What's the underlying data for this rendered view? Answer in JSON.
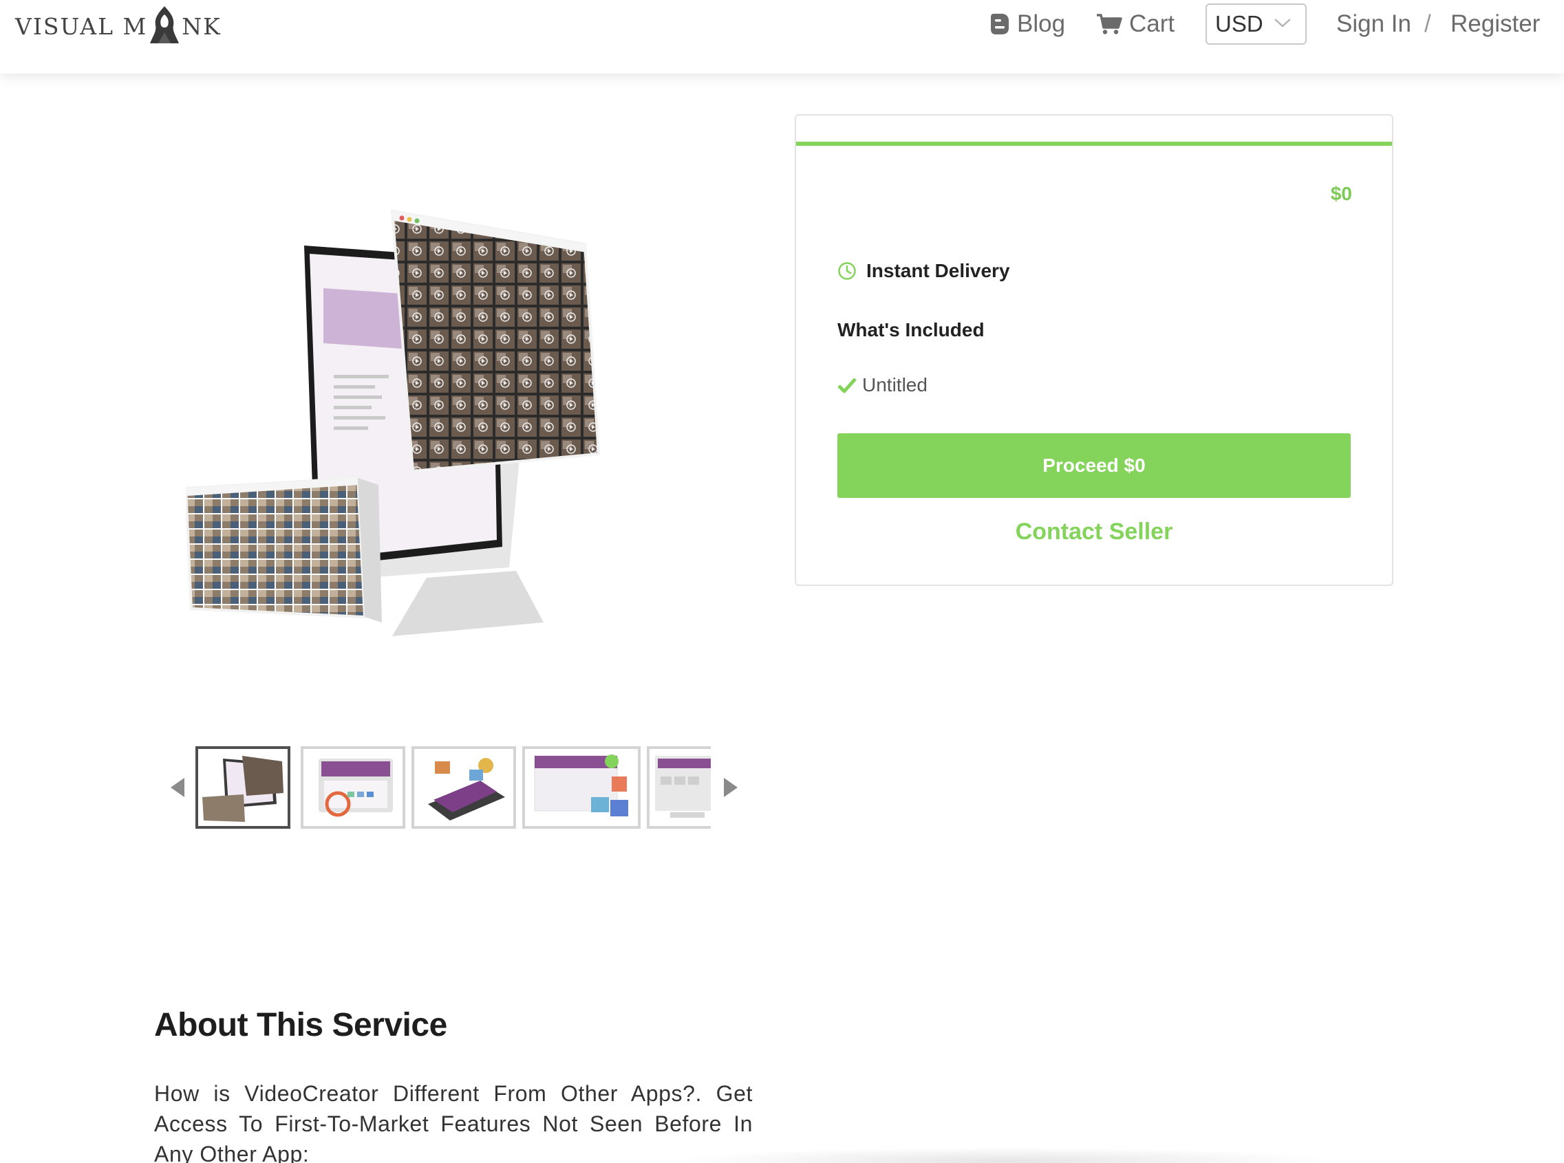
{
  "header": {
    "logo_text_left": "VISUAL M",
    "logo_text_right": "NK",
    "blog_label": "Blog",
    "cart_label": "Cart",
    "currency": "USD",
    "signin_label": "Sign In",
    "separator": "/",
    "register_label": "Register"
  },
  "gallery": {
    "thumb_count": 5,
    "active_index": 0
  },
  "order": {
    "price": "$0",
    "delivery_label": "Instant Delivery",
    "included_title": "What's Included",
    "included_items": [
      "Untitled"
    ],
    "proceed_label": "Proceed $0",
    "contact_label": "Contact Seller"
  },
  "about": {
    "title": "About This Service",
    "text": "How is VideoCreator Different From Other Apps?. Get Access To First-To-Market Features Not Seen Before In Any Other App:"
  },
  "colors": {
    "accent": "#84d35b",
    "text_dark": "#222222",
    "nav_text": "#6b6b6b",
    "brand_purple": "#9b6aa8"
  },
  "icons": {
    "blog": "blogger-icon",
    "cart": "cart-icon",
    "currency": "chevron-down-icon",
    "delivery": "clock-icon",
    "included": "check-icon",
    "prev": "arrow-left-icon",
    "next": "arrow-right-icon"
  }
}
